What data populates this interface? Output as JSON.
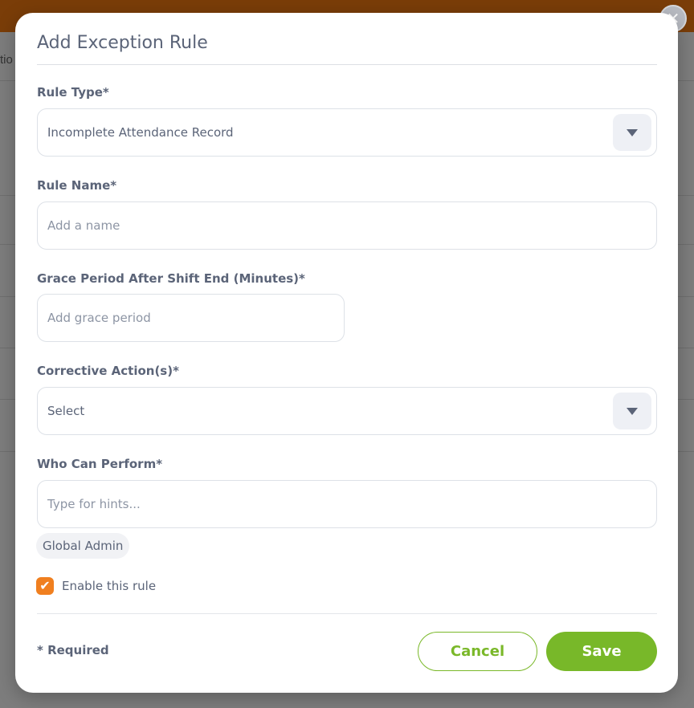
{
  "background": {
    "partial_text": "tio"
  },
  "modal": {
    "title": "Add Exception Rule",
    "close_icon": "✕",
    "rule_type": {
      "label": "Rule Type*",
      "value": "Incomplete Attendance Record"
    },
    "rule_name": {
      "label": "Rule Name*",
      "placeholder": "Add a name"
    },
    "grace_period": {
      "label": "Grace Period After Shift End (Minutes)*",
      "placeholder": "Add grace period"
    },
    "corrective_actions": {
      "label": "Corrective Action(s)*",
      "value": "Select"
    },
    "who_can_perform": {
      "label": "Who Can Perform*",
      "placeholder": "Type for hints...",
      "chips": [
        "Global Admin"
      ]
    },
    "enable": {
      "label": "Enable this rule",
      "checked": true
    },
    "footer": {
      "required_note": "* Required",
      "cancel_label": "Cancel",
      "save_label": "Save"
    }
  },
  "colors": {
    "accent_green": "#78b829",
    "checkbox_orange": "#f07f1f",
    "text": "#5b6478"
  }
}
